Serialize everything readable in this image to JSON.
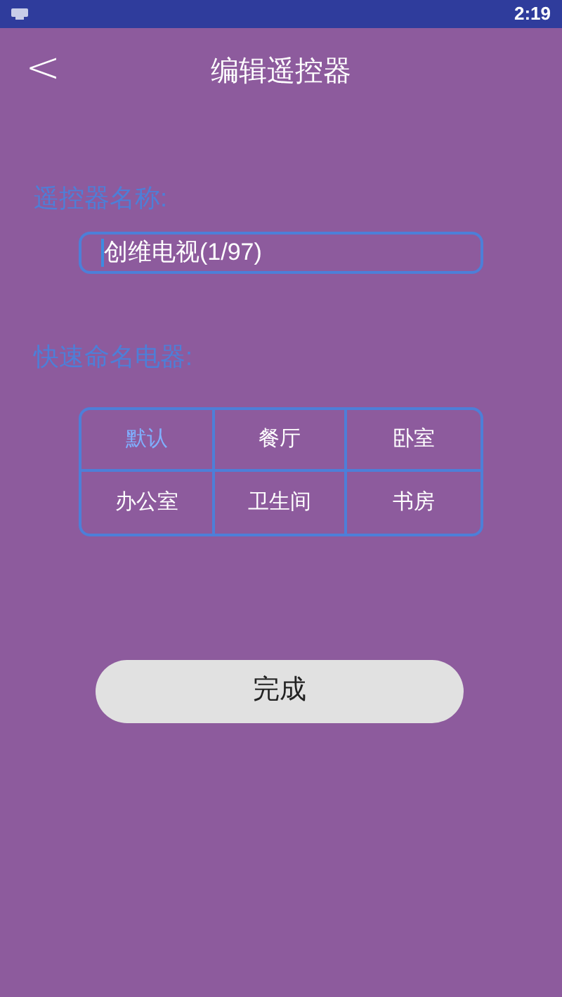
{
  "status_bar": {
    "time": "2:19"
  },
  "header": {
    "back": "<",
    "title": "编辑遥控器"
  },
  "name_label": "遥控器名称:",
  "name_field": {
    "value": "创维电视(1/97)",
    "focused": true
  },
  "quick_label": "快速命名电器:",
  "presets": [
    {
      "label": "默认",
      "selected": true
    },
    {
      "label": "餐厅",
      "selected": false
    },
    {
      "label": "卧室",
      "selected": false
    },
    {
      "label": "办公室",
      "selected": false
    },
    {
      "label": "卫生间",
      "selected": false
    },
    {
      "label": "书房",
      "selected": false
    }
  ],
  "done_button": "完成"
}
